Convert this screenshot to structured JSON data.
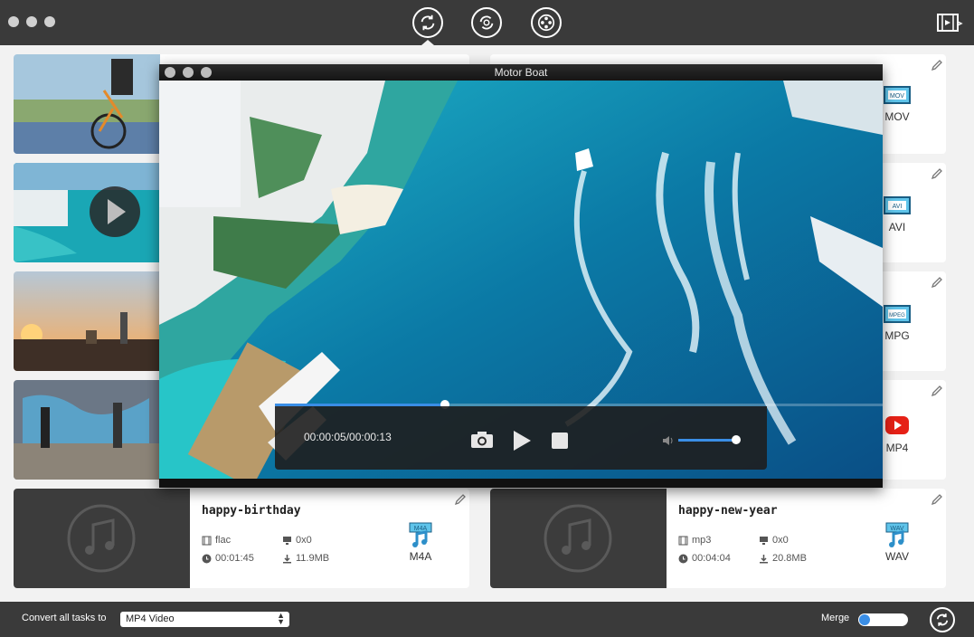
{
  "colors": {
    "accent": "#3a8ee6",
    "topbar": "#3a3a3a",
    "background": "#f2f2f2"
  },
  "toolbar": {
    "tools": [
      {
        "name": "convert-tool",
        "icon": "convert-icon",
        "active": true
      },
      {
        "name": "rotate-tool",
        "icon": "rotate-icon",
        "active": false
      },
      {
        "name": "film-reel-tool",
        "icon": "film-reel-icon",
        "active": false
      }
    ],
    "media_icon": "media-browser-icon"
  },
  "tasks": [
    {
      "thumb": "cyclist",
      "format": "MOV",
      "format_icon": "mov-file-icon"
    },
    {
      "thumb": "motor-boat",
      "format": "AVI",
      "format_icon": "avi-file-icon"
    },
    {
      "thumb": "city-sunset",
      "format": "MPG",
      "format_icon": "mpeg-file-icon"
    },
    {
      "thumb": "graffiti-dancers",
      "format": "MP4",
      "format_icon": "youtube-icon"
    }
  ],
  "audio_tasks": [
    {
      "title": "happy-birthday",
      "codec": "flac",
      "resolution": "0x0",
      "duration": "00:01:45",
      "size": "11.9MB",
      "format": "M4A",
      "format_icon": "m4a-file-icon"
    },
    {
      "title": "happy-new-year",
      "codec": "mp3",
      "resolution": "0x0",
      "duration": "00:04:04",
      "size": "20.8MB",
      "format": "WAV",
      "format_icon": "wav-file-icon"
    }
  ],
  "player": {
    "title": "Motor Boat",
    "timecode": "00:00:05/00:00:13",
    "progress": 0.28,
    "volume": 1.0,
    "controls": [
      "camera-icon",
      "play-icon",
      "stop-icon",
      "volume-icon"
    ]
  },
  "bottom": {
    "convert_label": "Convert all tasks to",
    "selected_format": "MP4 Video",
    "merge_label": "Merge",
    "merge_on": false
  }
}
